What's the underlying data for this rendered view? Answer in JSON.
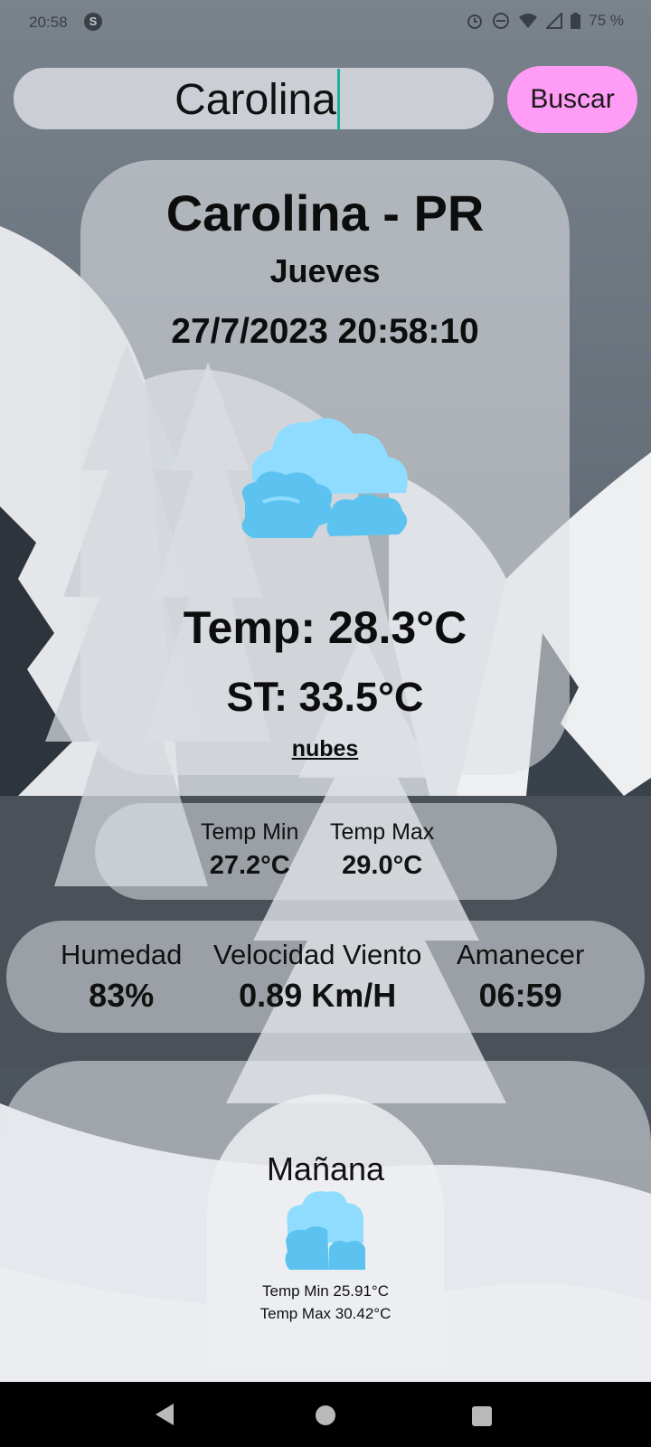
{
  "status_bar": {
    "time": "20:58",
    "battery": "75 %"
  },
  "search": {
    "value": "Carolina",
    "button_label": "Buscar"
  },
  "weather": {
    "city": "Carolina - PR",
    "day": "Jueves",
    "datetime": "27/7/2023 20:58:10",
    "icon": "cloud-icon",
    "temp": "Temp: 28.3°C",
    "feels_like": "ST: 33.5°C",
    "description": "nubes"
  },
  "range": {
    "min_label": "Temp Min",
    "min_value": "27.2°C",
    "max_label": "Temp Max",
    "max_value": "29.0°C"
  },
  "stats": [
    {
      "label": "Humedad",
      "value": "83%"
    },
    {
      "label": "Velocidad Viento",
      "value": "0.89 Km/H"
    },
    {
      "label": "Amanecer",
      "value": "06:59"
    }
  ],
  "forecast": {
    "title": "Mañana",
    "icon": "cloud-icon",
    "min": "Temp Min 25.91°C",
    "max": "Temp Max 30.42°C"
  },
  "colors": {
    "button": "#ff9df6",
    "caret": "#1fb0a4",
    "cloud_light": "#8fdcff",
    "cloud_dark": "#5cc3f0"
  }
}
